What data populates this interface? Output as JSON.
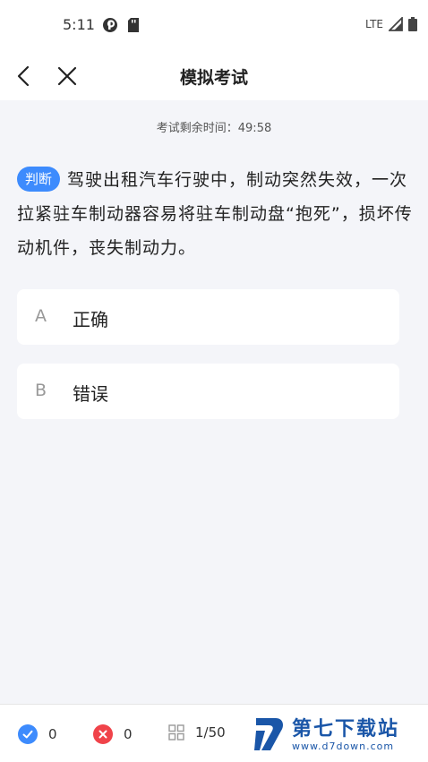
{
  "status_bar": {
    "time": "5:11",
    "network": "LTE",
    "icons": [
      "p-circle-icon",
      "sd-card-icon",
      "signal-icon",
      "battery-icon"
    ]
  },
  "nav": {
    "title": "模拟考试",
    "back_icon": "chevron-left-icon",
    "close_icon": "close-icon"
  },
  "timer": {
    "label": "考试剩余时间：",
    "value": "49:58"
  },
  "question": {
    "type_badge": "判断",
    "text": "驾驶出租汽车行驶中，制动突然失效，一次拉紧驻车制动器容易将驻车制动盘“抱死”，损坏传动机件，丧失制动力。"
  },
  "options": [
    {
      "letter": "A",
      "text": "正确"
    },
    {
      "letter": "B",
      "text": "错误"
    }
  ],
  "bottom_bar": {
    "correct_count": "0",
    "wrong_count": "0",
    "progress": "1/50"
  },
  "watermark": {
    "main": "第七下载站",
    "sub": "www.d7down.com"
  },
  "colors": {
    "accent": "#3d8bfd",
    "correct": "#3d8bfd",
    "wrong": "#f0434a",
    "background": "#f4f5f9"
  }
}
